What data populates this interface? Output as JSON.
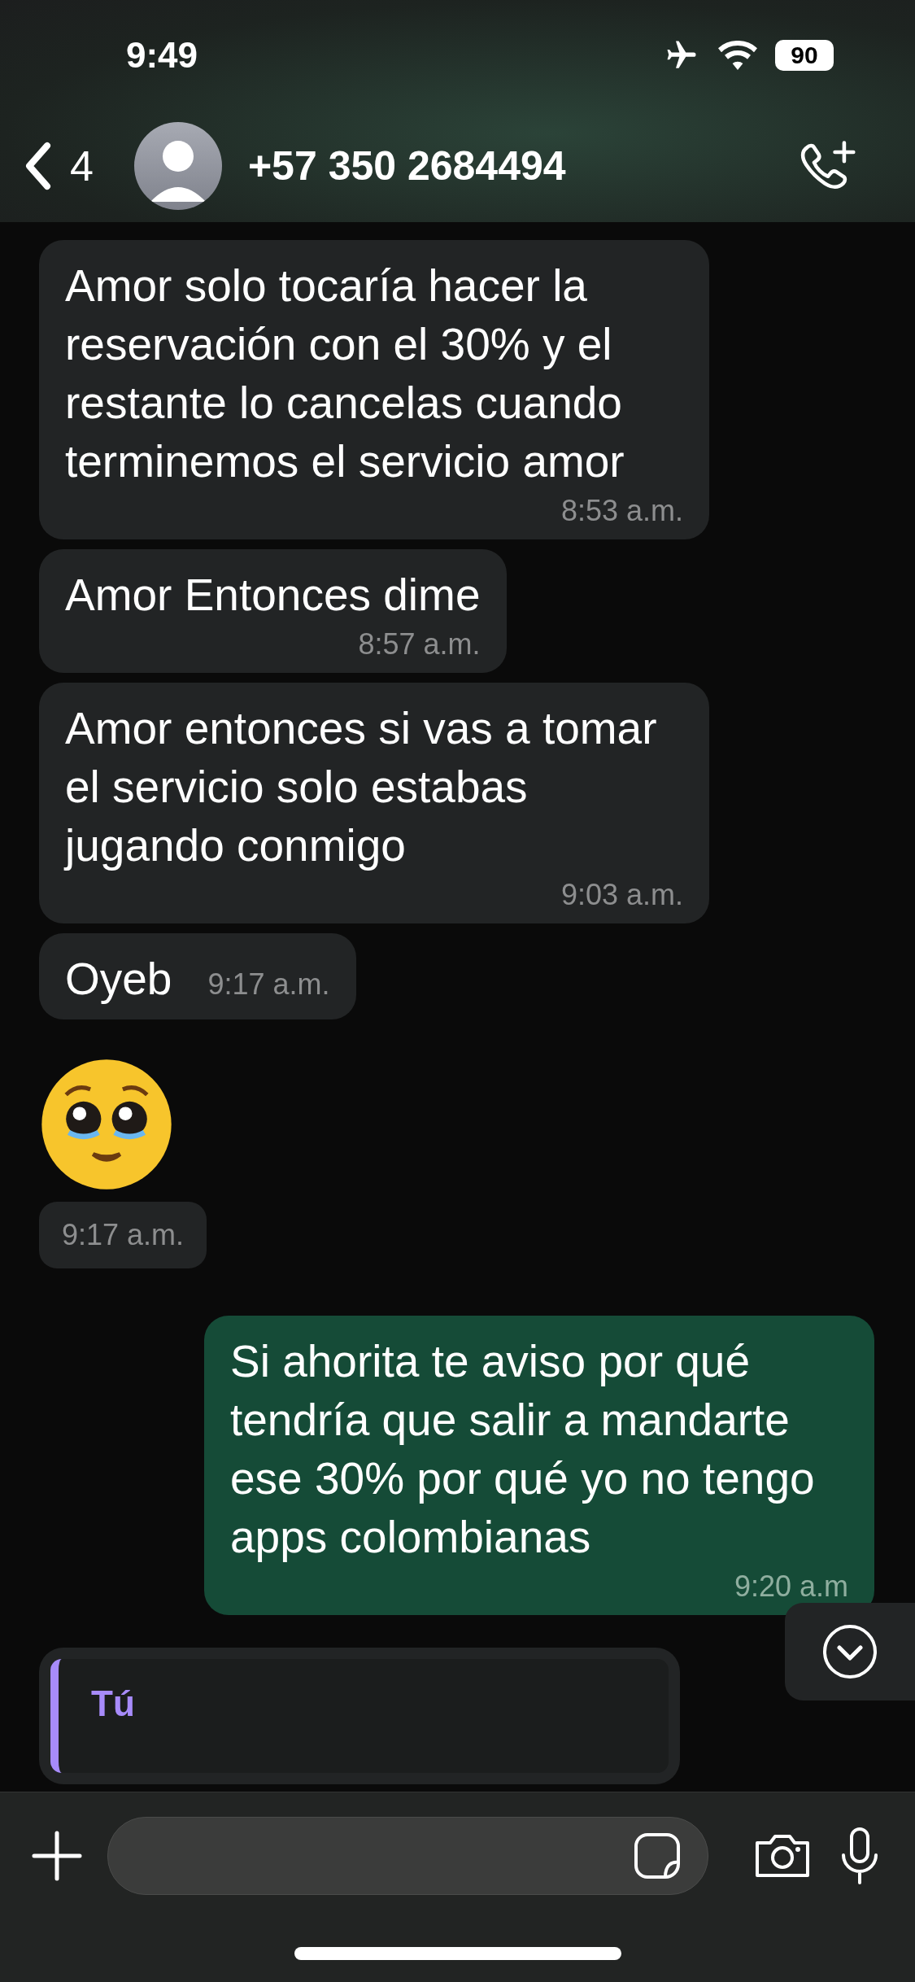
{
  "status_bar": {
    "time": "9:49",
    "airplane_mode": true,
    "battery": "90"
  },
  "header": {
    "back_count": "4",
    "contact": "+57 350 2684494"
  },
  "messages": [
    {
      "kind": "text",
      "outgoing": false,
      "text": "Amor solo tocaría hacer la reservación con el 30% y el restante lo cancelas cuando terminemos el servicio amor",
      "time": "8:53 a.m."
    },
    {
      "kind": "text",
      "outgoing": false,
      "text": "Amor Entonces dime",
      "time": "8:57 a.m."
    },
    {
      "kind": "text",
      "outgoing": false,
      "text": "Amor entonces si vas a tomar el servicio solo estabas jugando conmigo",
      "time": "9:03 a.m."
    },
    {
      "kind": "inline",
      "outgoing": false,
      "text": "Oyeb",
      "time": "9:17 a.m."
    },
    {
      "kind": "emoji",
      "outgoing": false,
      "time": "9:17 a.m."
    },
    {
      "kind": "text",
      "outgoing": true,
      "text": "Si ahorita te aviso por qué tendría que salir a mandarte ese 30% por qué yo no tengo apps colombianas",
      "time": "9:20 a.m"
    },
    {
      "kind": "reply",
      "outgoing": false,
      "quote_author": "Tú"
    }
  ]
}
